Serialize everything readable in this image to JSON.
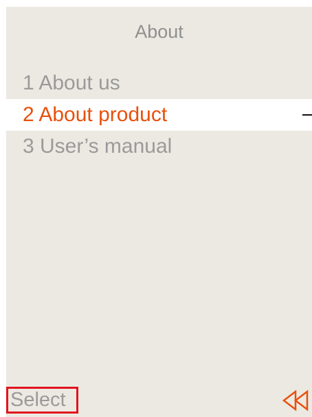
{
  "screen": {
    "title": "About",
    "menu": [
      {
        "label": "1 About us",
        "selected": false
      },
      {
        "label": "2 About product",
        "selected": true
      },
      {
        "label": "3 User’s manual",
        "selected": false
      }
    ]
  },
  "softkeys": {
    "left_label": "Select",
    "right_icon": "back-icon"
  },
  "colors": {
    "background": "#ece9e2",
    "selected_row": "#ffffff",
    "selected_text": "#e8500c",
    "text": "#9a9a9a",
    "focus_outline": "#e0141e"
  }
}
